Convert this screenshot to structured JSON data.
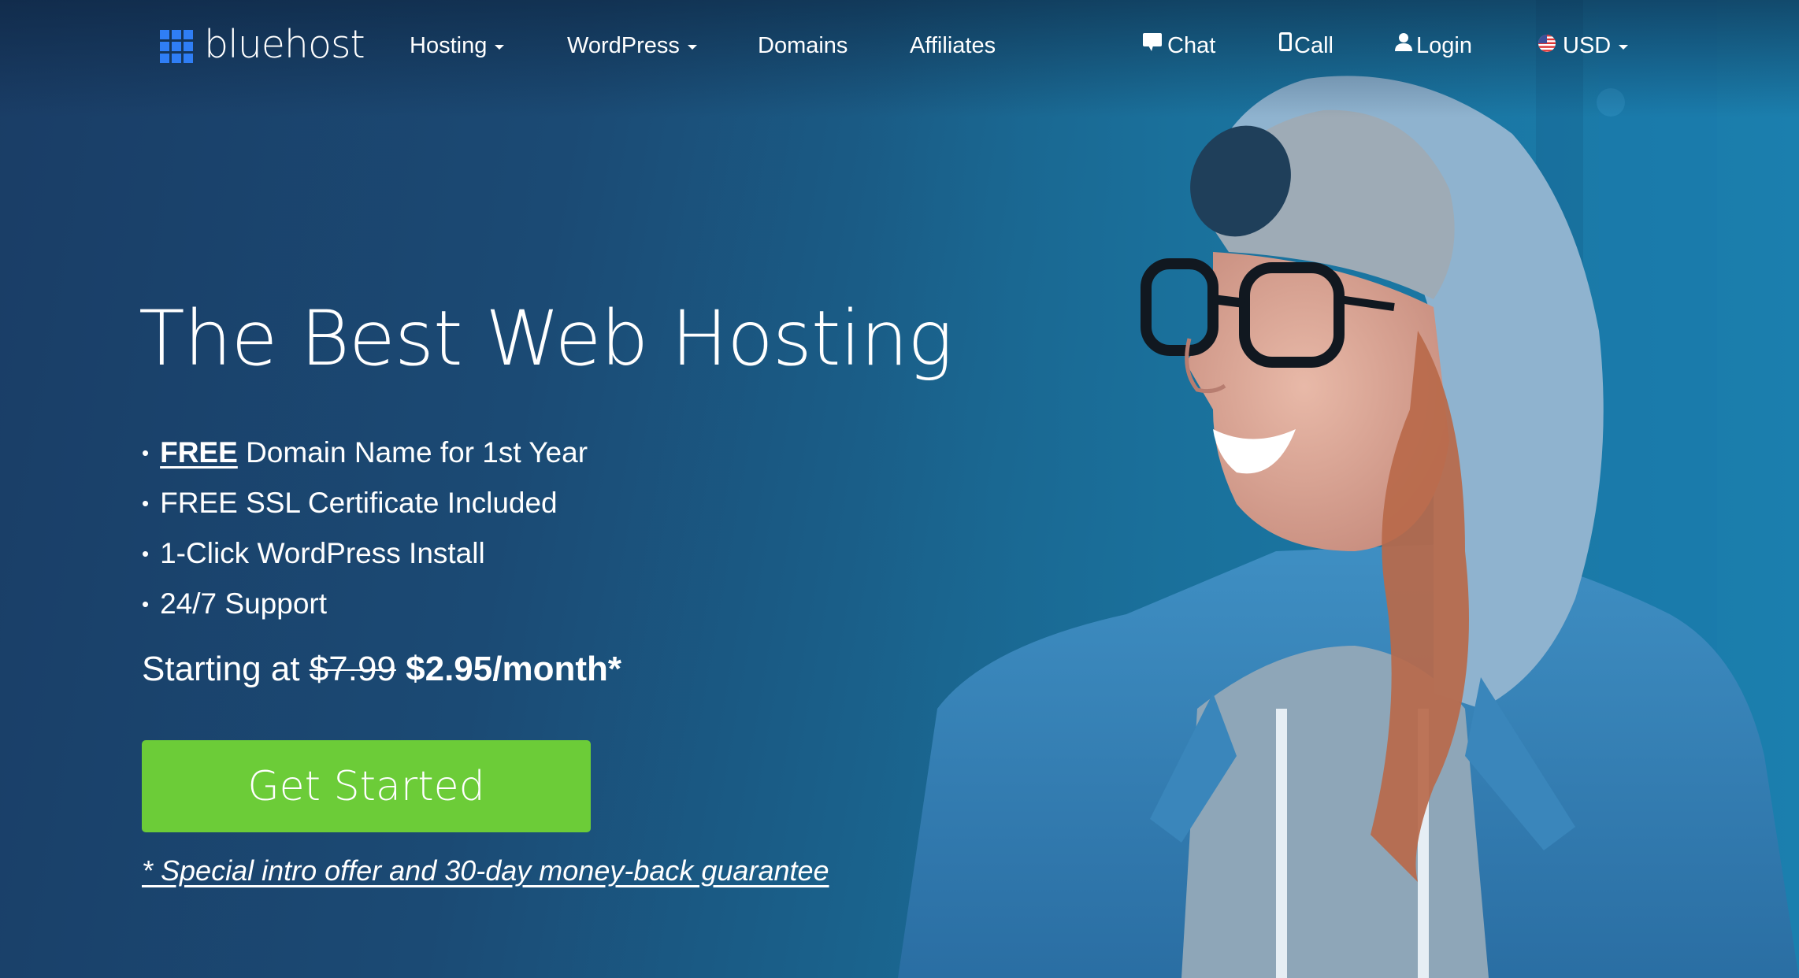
{
  "brand": {
    "name": "bluehost",
    "logo_icon": "grid-logo-icon",
    "logo_color": "#2f7ef5"
  },
  "nav": {
    "items": [
      {
        "label": "Hosting",
        "has_dropdown": true
      },
      {
        "label": "WordPress",
        "has_dropdown": true
      },
      {
        "label": "Domains",
        "has_dropdown": false
      },
      {
        "label": "Affiliates",
        "has_dropdown": false
      }
    ],
    "utility": [
      {
        "label": "Chat",
        "icon": "chat-bubble-icon"
      },
      {
        "label": "Call",
        "icon": "phone-icon"
      },
      {
        "label": "Login",
        "icon": "user-icon"
      },
      {
        "label": "USD",
        "icon": "us-flag-icon",
        "has_dropdown": true
      }
    ]
  },
  "hero": {
    "headline": "The Best Web Hosting",
    "bullets": [
      {
        "emphasis": "FREE",
        "text": " Domain Name for 1st Year"
      },
      {
        "emphasis": "",
        "text": "FREE SSL Certificate Included"
      },
      {
        "emphasis": "",
        "text": "1-Click WordPress Install"
      },
      {
        "emphasis": "",
        "text": "24/7 Support"
      }
    ],
    "bullet_glyph": "•",
    "price": {
      "prefix": "Starting at ",
      "old_price": "$7.99",
      "new_price": "$2.95/month*"
    },
    "cta_label": "Get Started",
    "cta_color": "#6ccc38",
    "disclaimer": "* Special intro offer and 30-day money-back guarantee"
  },
  "colors": {
    "background_dark": "#1a3d66",
    "background_light": "#1a7cab",
    "text": "#ffffff"
  }
}
